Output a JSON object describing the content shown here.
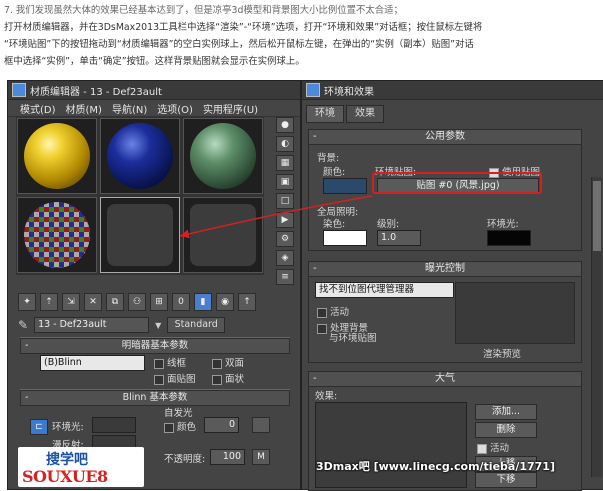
{
  "article": {
    "line1": "7. 我们发现虽然大体的效果已经基本达到了，但是凉亭3d模型和背景图大小比例位置不太合适；",
    "line2": "打开材质编辑器，并在3DsMax2013工具栏中选择“渲染”-“环境”选项，打开“环境和效果”对话框；按住鼠标左键将",
    "line3": "“环境贴图”下的按钮拖动到“材质编辑器”的空白实例球上，然后松开鼠标左键，在弹出的“实例（副本）贴图”对话",
    "line4": "框中选择“实例”，单击“确定”按钮。这样背景贴图就会显示在实例球上。"
  },
  "material_editor": {
    "title": "材质编辑器 - 13 - Def23ault",
    "menu": [
      "模式(D)",
      "材质(M)",
      "导航(N)",
      "选项(O)",
      "实用程序(U)"
    ],
    "material_name": "13 - Def23ault",
    "standard_label": "Standard",
    "shader_rollout": "明暗器基本参数",
    "shader_value": "(B)Blinn",
    "opt_wire": "线框",
    "opt_two_sided": "双面",
    "opt_face_map": "面贴图",
    "opt_faceted": "面状",
    "blinn_rollout": "Blinn 基本参数",
    "self_illum": "自发光",
    "ambient_label": "环境光:",
    "diffuse_label": "漫反射:",
    "color_label": "颜色",
    "color_value": "0",
    "opacity_label": "不透明度:",
    "opacity_value": "100",
    "m_label": "M"
  },
  "environment": {
    "title": "环境和效果",
    "tabs": [
      "环境",
      "效果"
    ],
    "common_params": "公用参数",
    "background": "背景:",
    "color_label": "颜色:",
    "env_map_label": "环境贴图:",
    "use_map": "使用贴图",
    "map_button": "贴图 #0 (风景.jpg)",
    "global_lighting": "全局照明:",
    "tint_label": "染色:",
    "level_label": "级别:",
    "level_value": "1.0",
    "ambient_label": "环境光:",
    "exposure_rollout": "曝光控制",
    "exposure_value": "找不到位图代理管理器",
    "active_label": "活动",
    "process_bg": "处理背景",
    "and_env_map": "与环境贴图",
    "render_preview": "渲染预览",
    "atmosphere_rollout": "大气",
    "effects_label": "效果:",
    "add_button": "添加...",
    "delete_button": "删除",
    "active2_label": "活动",
    "move_up": "上移",
    "move_down": "下移"
  },
  "watermarks": {
    "left_cn": "搜学吧",
    "left_en": "SOUXUE8",
    "right": "3Dmax吧 [www.linecg.com/tieba/1771]"
  },
  "colors": {
    "ui_bg": "#444444",
    "highlight_red": "#d42020",
    "bg_color_swatch": "#2a4a6a"
  }
}
